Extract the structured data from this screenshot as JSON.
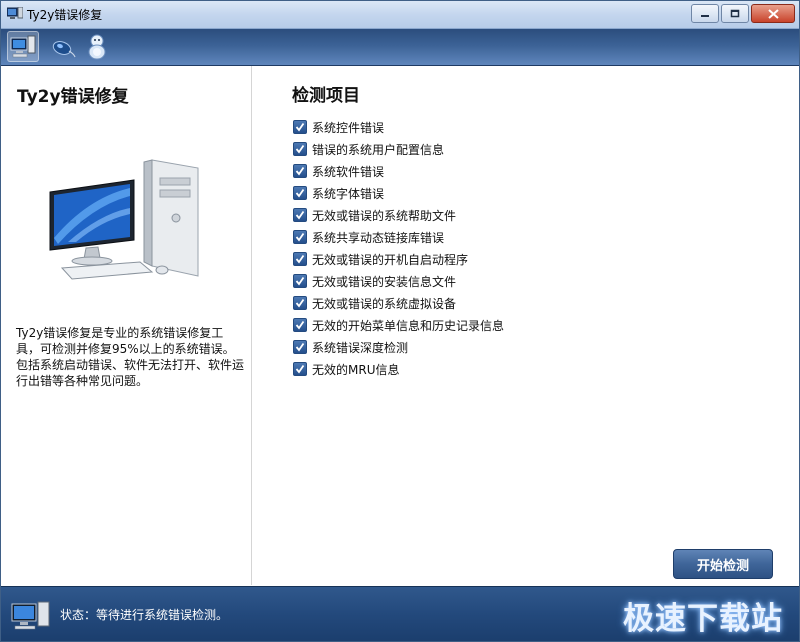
{
  "window": {
    "title": "Ty2y错误修复",
    "controls": [
      "minimize-icon",
      "maximize-icon",
      "close-icon"
    ]
  },
  "toolbar": {
    "items": [
      {
        "icon": "computer-icon",
        "active": true
      },
      {
        "icon": "mouse-icon",
        "active": false
      },
      {
        "icon": "mascot-icon",
        "active": false
      }
    ]
  },
  "left_panel": {
    "title": "Ty2y错误修复",
    "description": [
      "Ty2y错误修复是专业的系统错误修复工具，可检测并修复95%以上的系统错误。",
      "包括系统启动错误、软件无法打开、软件运行出错等各种常见问题。"
    ]
  },
  "right_panel": {
    "title": "检测项目",
    "items": [
      {
        "label": "系统控件错误",
        "checked": true
      },
      {
        "label": "错误的系统用户配置信息",
        "checked": true
      },
      {
        "label": "系统软件错误",
        "checked": true
      },
      {
        "label": "系统字体错误",
        "checked": true
      },
      {
        "label": "无效或错误的系统帮助文件",
        "checked": true
      },
      {
        "label": "系统共享动态链接库错误",
        "checked": true
      },
      {
        "label": "无效或错误的开机自启动程序",
        "checked": true
      },
      {
        "label": "无效或错误的安装信息文件",
        "checked": true
      },
      {
        "label": "无效或错误的系统虚拟设备",
        "checked": true
      },
      {
        "label": "无效的开始菜单信息和历史记录信息",
        "checked": true
      },
      {
        "label": "系统错误深度检测",
        "checked": true
      },
      {
        "label": "无效的MRU信息",
        "checked": true
      }
    ],
    "start_button": "开始检测"
  },
  "status": {
    "text": "状态：等待进行系统错误检测。",
    "watermark": "极速下载站"
  },
  "colors": {
    "toolbar_blue": "#3c6296",
    "status_blue": "#23497c",
    "checkbox_blue": "#2e5c99",
    "close_red": "#c8432b"
  }
}
